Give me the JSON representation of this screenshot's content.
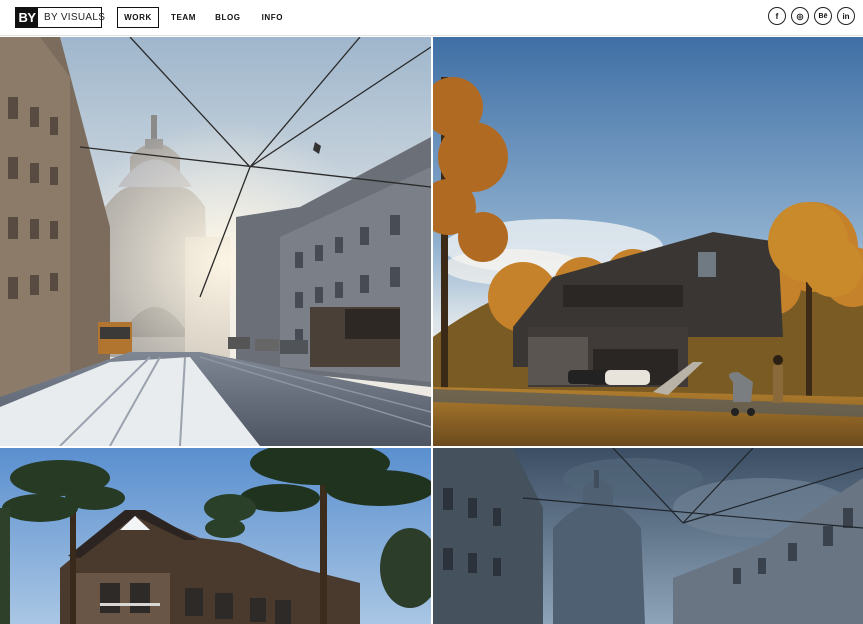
{
  "brand": {
    "mark": "BY",
    "name": "BY VISUALS"
  },
  "nav": {
    "items": [
      {
        "label": "WORK",
        "active": true
      },
      {
        "label": "TEAM"
      },
      {
        "label": "BLOG"
      },
      {
        "label": "INFO"
      }
    ]
  },
  "social": [
    {
      "icon": "facebook-icon",
      "glyph": "f"
    },
    {
      "icon": "instagram-icon",
      "glyph": "◎"
    },
    {
      "icon": "behance-icon",
      "glyph": "Bē"
    },
    {
      "icon": "linkedin-icon",
      "glyph": "in"
    }
  ],
  "gallery": {
    "items": [
      {
        "name": "snowy-street-basilica"
      },
      {
        "name": "autumn-modern-house"
      },
      {
        "name": "pine-forest-house"
      },
      {
        "name": "stormy-street-basilica"
      }
    ]
  },
  "colors": {
    "ink": "#111111",
    "divider": "#e2e2e2",
    "background": "#ffffff"
  }
}
